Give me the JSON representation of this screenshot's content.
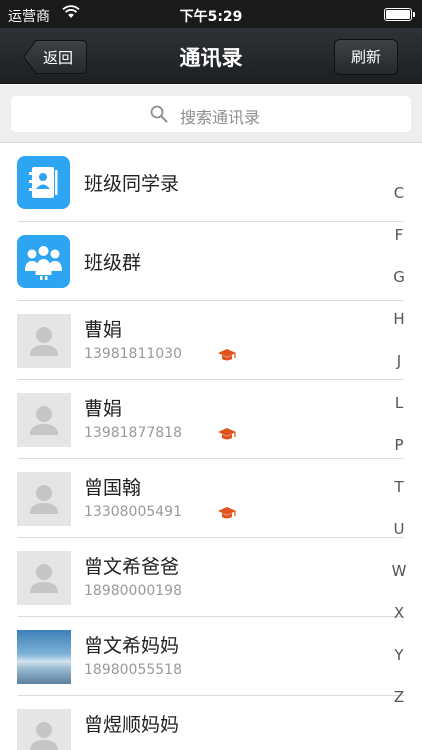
{
  "status": {
    "carrier": "运营商",
    "time": "下午5:29"
  },
  "nav": {
    "title": "通讯录",
    "back_label": "返回",
    "refresh_label": "刷新"
  },
  "search": {
    "placeholder": "搜索通讯录"
  },
  "entries": [
    {
      "name": "班级同学录"
    },
    {
      "name": "班级群"
    }
  ],
  "contacts": [
    {
      "name": "曹娟",
      "phone": "13981811030",
      "teacher_badge": true
    },
    {
      "name": "曹娟",
      "phone": "13981877818",
      "teacher_badge": true
    },
    {
      "name": "曾国翰",
      "phone": "13308005491",
      "teacher_badge": true
    },
    {
      "name": "曾文希爸爸",
      "phone": "18980000198",
      "teacher_badge": false
    },
    {
      "name": "曾文希妈妈",
      "phone": "18980055518",
      "teacher_badge": false,
      "photo": true
    },
    {
      "name": "曾煜顺妈妈",
      "phone": "",
      "teacher_badge": false
    }
  ],
  "index_letters": [
    "C",
    "F",
    "G",
    "H",
    "J",
    "L",
    "P",
    "T",
    "U",
    "W",
    "X",
    "Y",
    "Z"
  ],
  "colors": {
    "accent_blue": "#2ea5f3",
    "badge_orange": "#e0531c",
    "nav_dark": "#24282b"
  },
  "icons": {
    "wifi": "wifi-icon",
    "battery": "battery-icon",
    "search": "search-icon",
    "contacts_book": "contacts-book-icon",
    "group": "group-icon",
    "avatar": "person-placeholder-icon",
    "badge": "graduation-cap-icon"
  }
}
